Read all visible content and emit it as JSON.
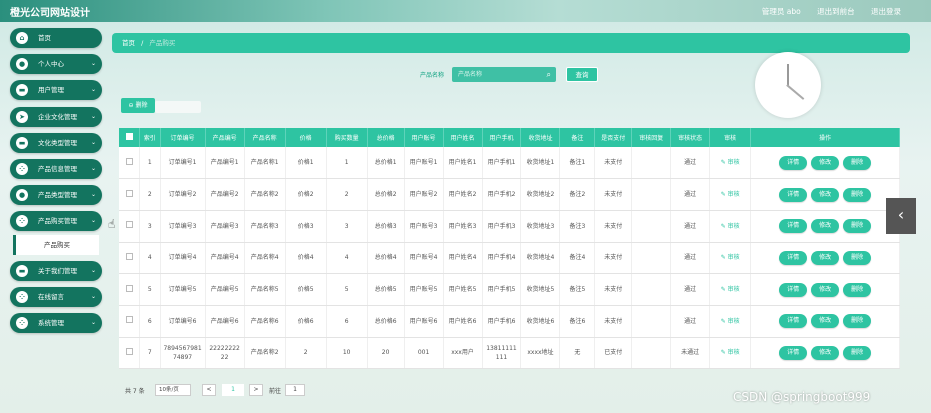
{
  "header": {
    "title": "橙光公司网站设计",
    "user": "管理员 abo",
    "back_link": "退出到前台",
    "logout": "退出登录"
  },
  "sidebar": {
    "items": [
      {
        "label": "首页",
        "icon": "home-icon",
        "glyph": "⌂",
        "chevron": false
      },
      {
        "label": "个人中心",
        "icon": "user-icon",
        "glyph": "●",
        "chevron": true
      },
      {
        "label": "用户管理",
        "icon": "users-icon",
        "glyph": "▬",
        "chevron": true
      },
      {
        "label": "企业文化管理",
        "icon": "send-icon",
        "glyph": "➤",
        "chevron": true
      },
      {
        "label": "文化类型管理",
        "icon": "list-icon",
        "glyph": "▬",
        "chevron": true
      },
      {
        "label": "产品信息管理",
        "icon": "grid-icon",
        "glyph": "⁘",
        "chevron": true
      },
      {
        "label": "产品类型管理",
        "icon": "pin-icon",
        "glyph": "●",
        "chevron": true
      },
      {
        "label": "产品购买管理",
        "icon": "grid-icon",
        "glyph": "⁘",
        "chevron": true
      },
      {
        "label": "关于我们管理",
        "icon": "list-icon",
        "glyph": "▬",
        "chevron": true
      },
      {
        "label": "在线留言",
        "icon": "grid-icon",
        "glyph": "⁘",
        "chevron": true
      },
      {
        "label": "系统管理",
        "icon": "grid-icon",
        "glyph": "⁘",
        "chevron": true
      }
    ],
    "active_submenu": "产品购买"
  },
  "breadcrumb": {
    "home": "首页",
    "separator": "/",
    "current": "产品购买"
  },
  "search": {
    "label": "产品名称",
    "placeholder": "产品名称",
    "button": "查询"
  },
  "toolbar": {
    "delete_label": "删除"
  },
  "table": {
    "headers": [
      "索引",
      "订单编号",
      "产品编号",
      "产品名称",
      "价格",
      "购买数量",
      "总价格",
      "用户账号",
      "用户姓名",
      "用户手机",
      "收货地址",
      "备注",
      "是否支付",
      "审核回复",
      "审核状态",
      "审核",
      "操作"
    ],
    "rows": [
      [
        "1",
        "订单编号1",
        "产品编号1",
        "产品名称1",
        "价格1",
        "1",
        "总价格1",
        "用户账号1",
        "用户姓名1",
        "用户手机1",
        "收货地址1",
        "备注1",
        "未支付",
        "",
        "通过"
      ],
      [
        "2",
        "订单编号2",
        "产品编号2",
        "产品名称2",
        "价格2",
        "2",
        "总价格2",
        "用户账号2",
        "用户姓名2",
        "用户手机2",
        "收货地址2",
        "备注2",
        "未支付",
        "",
        "通过"
      ],
      [
        "3",
        "订单编号3",
        "产品编号3",
        "产品名称3",
        "价格3",
        "3",
        "总价格3",
        "用户账号3",
        "用户姓名3",
        "用户手机3",
        "收货地址3",
        "备注3",
        "未支付",
        "",
        "通过"
      ],
      [
        "4",
        "订单编号4",
        "产品编号4",
        "产品名称4",
        "价格4",
        "4",
        "总价格4",
        "用户账号4",
        "用户姓名4",
        "用户手机4",
        "收货地址4",
        "备注4",
        "未支付",
        "",
        "通过"
      ],
      [
        "5",
        "订单编号5",
        "产品编号5",
        "产品名称5",
        "价格5",
        "5",
        "总价格5",
        "用户账号5",
        "用户姓名5",
        "用户手机5",
        "收货地址5",
        "备注5",
        "未支付",
        "",
        "通过"
      ],
      [
        "6",
        "订单编号6",
        "产品编号6",
        "产品名称6",
        "价格6",
        "6",
        "总价格6",
        "用户账号6",
        "用户姓名6",
        "用户手机6",
        "收货地址6",
        "备注6",
        "未支付",
        "",
        "通过"
      ],
      [
        "7",
        "789456798174897",
        "2222222222",
        "产品名称2",
        "2",
        "10",
        "20",
        "001",
        "xxx用户",
        "13811111111",
        "xxxx地址",
        "无",
        "已支付",
        "",
        "未通过"
      ]
    ],
    "audit_label": "✎ 审核",
    "actions": [
      "详情",
      "修改",
      "删除"
    ]
  },
  "pagination": {
    "total": "共 7 条",
    "page_size": "10条/页",
    "prev": "<",
    "current": "1",
    "next": ">",
    "goto": "前往",
    "goto_value": "1"
  },
  "watermark": "CSDN @springboot999",
  "colors": {
    "primary": "#2ec4a2",
    "sidebar": "#13745f"
  }
}
